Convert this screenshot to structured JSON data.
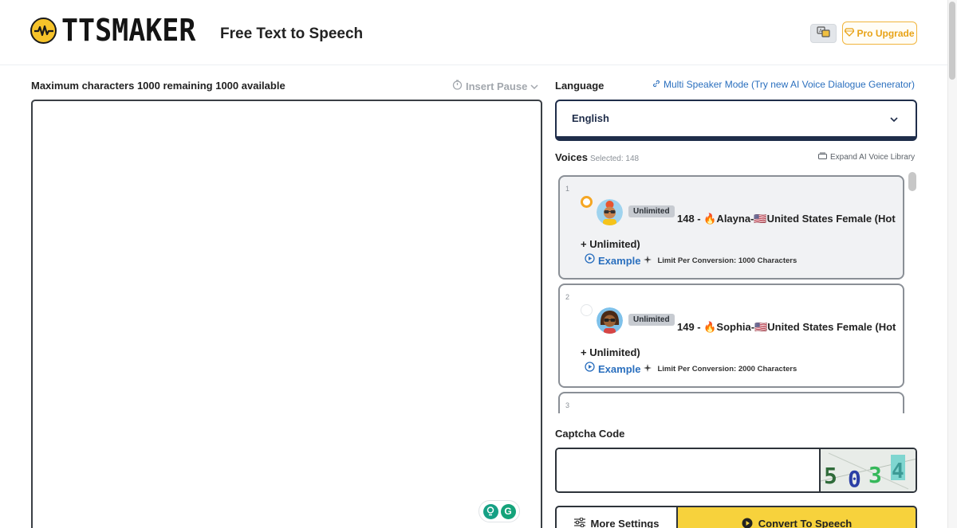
{
  "header": {
    "logo_text": "TTSMAKER",
    "tagline": "Free Text to Speech",
    "pro_upgrade_label": "Pro Upgrade",
    "brand_color": "#f6c32a"
  },
  "editor": {
    "char_info": "Maximum characters 1000 remaining 1000 available",
    "insert_pause_label": "Insert Pause",
    "text_value": ""
  },
  "language": {
    "label": "Language",
    "multi_speaker_link": "Multi Speaker Mode (Try new AI Voice Dialogue Generator)",
    "selected": "English"
  },
  "voices": {
    "label": "Voices",
    "selected_text": "Selected: 148",
    "expand_label": "Expand AI Voice Library",
    "items": [
      {
        "index": "1",
        "badge": "Unlimited",
        "title": "148 - 🔥Alayna-🇺🇸United States Female (Hot + Unlimited)",
        "example_label": "Example",
        "limit": "Limit Per Conversion: 1000 Characters",
        "selected": true
      },
      {
        "index": "2",
        "badge": "Unlimited",
        "title": "149 - 🔥Sophia-🇺🇸United States Female (Hot + Unlimited)",
        "example_label": "Example",
        "limit": "Limit Per Conversion: 2000 Characters",
        "selected": false
      },
      {
        "index": "3"
      }
    ]
  },
  "captcha": {
    "label": "Captcha Code",
    "value": "",
    "image_chars": [
      "5",
      "0",
      "3",
      "4"
    ]
  },
  "actions": {
    "more_settings_label": "More Settings",
    "convert_label": "Convert To Speech",
    "convert_color": "#f7d23c"
  }
}
